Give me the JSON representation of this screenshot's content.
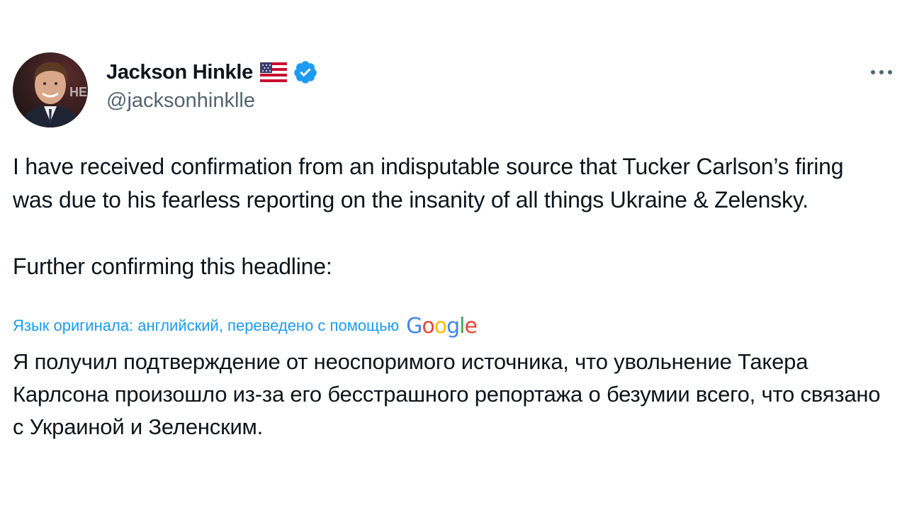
{
  "user": {
    "display_name": "Jackson Hinkle",
    "handle": "@jacksonhinklle",
    "flag_icon": "us-flag-icon",
    "verified_icon": "verified-badge-icon",
    "verified_color": "#1d9bf0"
  },
  "menu": {
    "more_icon": "more-options-icon"
  },
  "tweet": {
    "text": "I have received confirmation from an indisputable source that Tucker Carlson’s firing was due to his fearless reporting on the insanity of all things Ukraine & Zelensky.\n\nFurther confirming this headline:",
    "translation_label": "Язык оригинала: английский, переведено с помощью",
    "translation_provider": "Google",
    "translated_text": "Я получил подтверждение от неоспоримого источника, что увольнение Такера Карлсона произошло из-за его бесстрашного репортажа о безумии всего, что связано с Украиной и Зеленским.",
    "link_color": "#1d9bf0"
  }
}
